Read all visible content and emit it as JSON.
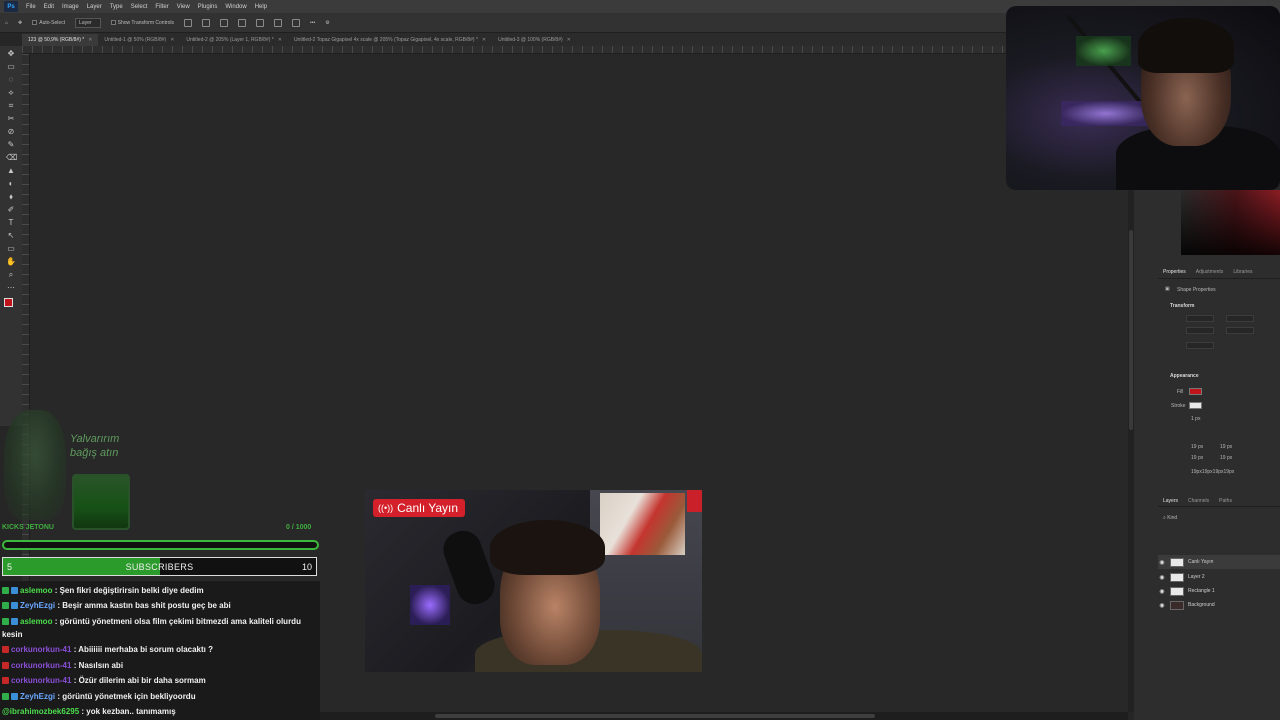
{
  "app": {
    "menu": [
      "File",
      "Edit",
      "Image",
      "Layer",
      "Type",
      "Select",
      "Filter",
      "View",
      "Plugins",
      "Window",
      "Help"
    ],
    "options": {
      "auto_select": "Auto-Select",
      "layer_select": "Layer",
      "transform_controls": "Show Transform Controls",
      "more": "•••"
    },
    "tabs": [
      {
        "label": "123 @ 50,9% (RGB/8#) *",
        "active": true
      },
      {
        "label": "Untitled-1 @ 50% (RGB/8#)",
        "active": false
      },
      {
        "label": "Untitled-2 @ 205% (Layer 1, RGB/8#) *",
        "active": false
      },
      {
        "label": "Untitled-2 Topaz Gigapixel 4x scale @ 205% (Topaz Gigapixel, 4x scale, RGB/8#) *",
        "active": false
      },
      {
        "label": "Untitled-3 @ 100% (RGB/8#)",
        "active": false
      }
    ],
    "tools": [
      "✥",
      "▭",
      "◌",
      "⟡",
      "⌗",
      "✂",
      "⊘",
      "✎",
      "⌫",
      "▲",
      "◐",
      "⬧",
      "✐",
      "T",
      "↖",
      "▭",
      "✋",
      "⌕",
      "⋯"
    ],
    "colors": {
      "foreground": "#c0131a",
      "background": "#111111"
    }
  },
  "properties": {
    "tabs": [
      "Properties",
      "Adjustments",
      "Libraries"
    ],
    "title": "Shape Properties",
    "transform": "Transform",
    "appearance": "Appearance",
    "fill_label": "Fill",
    "stroke_label": "Stroke",
    "stroke_width": "1 px",
    "radius": [
      "19 px",
      "19 px",
      "19 px",
      "19 px"
    ],
    "radius_summary": "19px19px19px19px"
  },
  "layers": {
    "tabs": [
      "Layers",
      "Channels",
      "Paths"
    ],
    "filter": "Kind",
    "items": [
      {
        "name": "Canlı Yayın",
        "thumb": "light",
        "selected": true
      },
      {
        "name": "Layer 2",
        "thumb": "light",
        "selected": false
      },
      {
        "name": "Rectangle 1",
        "thumb": "light",
        "selected": false
      },
      {
        "name": "Background",
        "thumb": "dark",
        "selected": false
      }
    ]
  },
  "overlay": {
    "donate_text_1": "Yalvarırım",
    "donate_text_2": "bağış atın",
    "goal_label": "KICKS JETONU",
    "goal_count": "0 / 1000",
    "goal_progress": 0.0,
    "subs_left": "5",
    "subs_label": "SUBSCRIBERS",
    "subs_right": "10",
    "subs_progress": 0.5
  },
  "chat": [
    {
      "user": "aslemoo",
      "color": "#4cdd4c",
      "badge": "#2fae4a",
      "text": " : Şen fikri değiştirirsin belki diye dedim"
    },
    {
      "user": "ZeyhEzgi",
      "color": "#6aa7ff",
      "badge": "#2fae4a",
      "text": " : Beşir amma kastın bas shit postu geç be abi"
    },
    {
      "user": "aslemoo",
      "color": "#4cdd4c",
      "badge": "#2fae4a",
      "text": " : görüntü yönetmeni olsa film çekimi bitmezdi ama kaliteli olurdu kesin"
    },
    {
      "user": "corkunorkun-41",
      "color": "#8a4fd6",
      "badge": "#c62828",
      "text": " : Abiiiiii merhaba bi sorum olacaktı ?"
    },
    {
      "user": "corkunorkun-41",
      "color": "#8a4fd6",
      "badge": "#c62828",
      "text": " : Nasılsın abi"
    },
    {
      "user": "corkunorkun-41",
      "color": "#8a4fd6",
      "badge": "#c62828",
      "text": " : Özür dilerim abi bir daha sormam"
    },
    {
      "user": "ZeyhEzgi",
      "color": "#6aa7ff",
      "badge": "#2fae4a",
      "text": " : görüntü yönetmek için bekliyoordu"
    },
    {
      "user": "@ibrahimozbek6295",
      "color": "#4cdd4c",
      "badge": "",
      "text": " : yok kezban.. tanımamış"
    }
  ],
  "live_badge": "Canlı Yayın"
}
